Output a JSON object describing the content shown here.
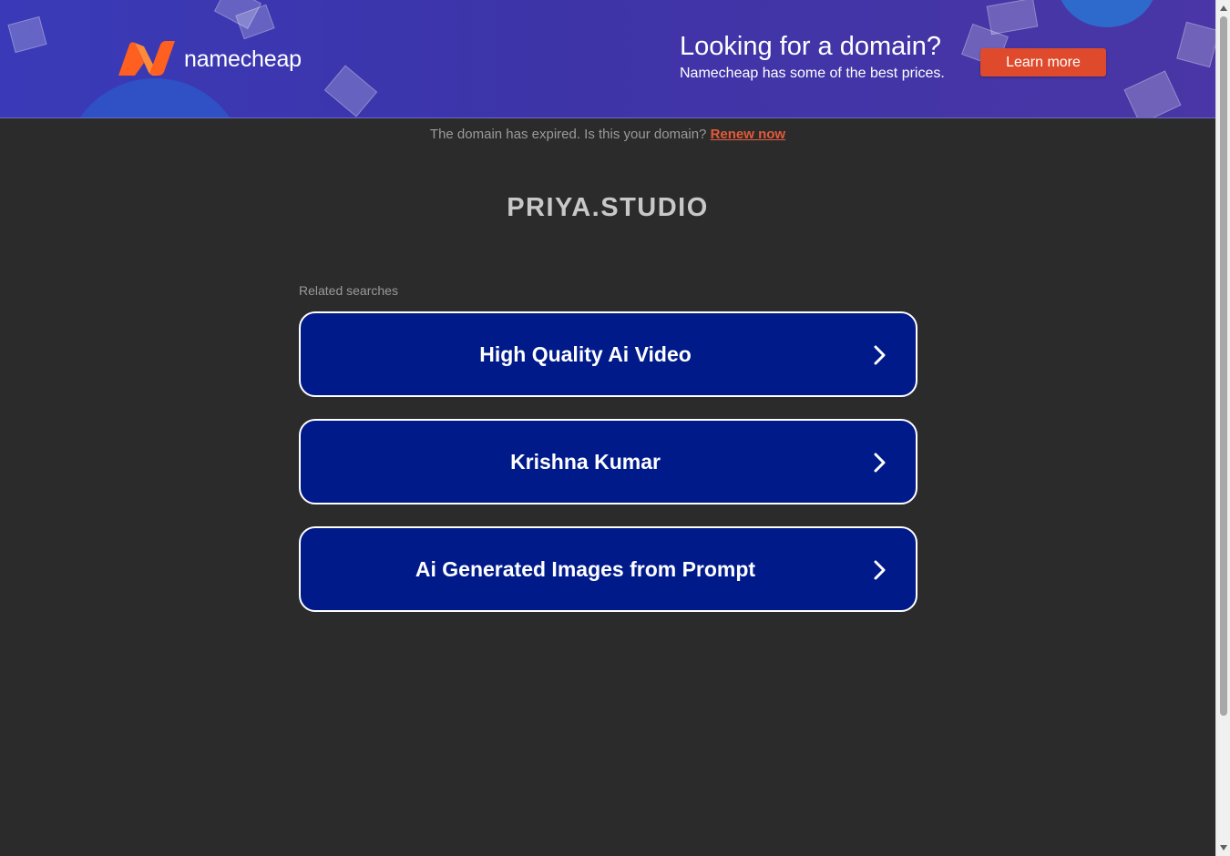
{
  "banner": {
    "logo_text": "namecheap",
    "promo_title": "Looking for a domain?",
    "promo_subtitle": "Namecheap has some of the best prices.",
    "cta_label": "Learn more",
    "colors": {
      "logo_orange": "#ff5f1f",
      "cta": "#e04a2c"
    }
  },
  "notice": {
    "text": "The domain has expired. Is this your domain?",
    "link_label": "Renew now"
  },
  "domain": {
    "name": "PRIYA.STUDIO"
  },
  "related": {
    "label": "Related searches",
    "items": [
      {
        "label": "High Quality Ai Video",
        "icon": "chevron-right-icon"
      },
      {
        "label": "Krishna Kumar",
        "icon": "chevron-right-icon"
      },
      {
        "label": "Ai Generated Images from Prompt",
        "icon": "chevron-right-icon"
      }
    ],
    "colors": {
      "button_bg": "#001a8a",
      "button_border": "#ffffff"
    }
  }
}
